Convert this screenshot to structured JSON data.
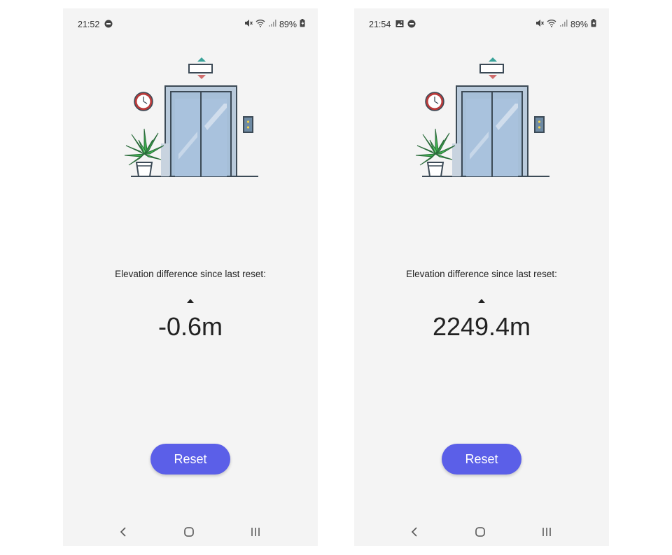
{
  "screens": [
    {
      "status": {
        "time": "21:52",
        "battery": "89%"
      },
      "elevation_label": "Elevation difference since last reset:",
      "elevation_value": "-0.6m",
      "reset_label": "Reset"
    },
    {
      "status": {
        "time": "21:54",
        "battery": "89%"
      },
      "elevation_label": "Elevation difference since last reset:",
      "elevation_value": "2249.4m",
      "reset_label": "Reset"
    }
  ],
  "icons": {
    "status": [
      "notification-icon",
      "mute-icon",
      "wifi-icon",
      "signal-icon",
      "battery-charging-icon"
    ],
    "status_right_screen_extra": "gallery-icon",
    "nav": [
      "back-icon",
      "home-icon",
      "recents-icon"
    ]
  },
  "colors": {
    "accent": "#5b5fe8",
    "screen_bg": "#f4f4f4",
    "elevator_glass": "#a9c2dd",
    "plant_green": "#3fb24f",
    "clock_red": "#b93b3b"
  }
}
